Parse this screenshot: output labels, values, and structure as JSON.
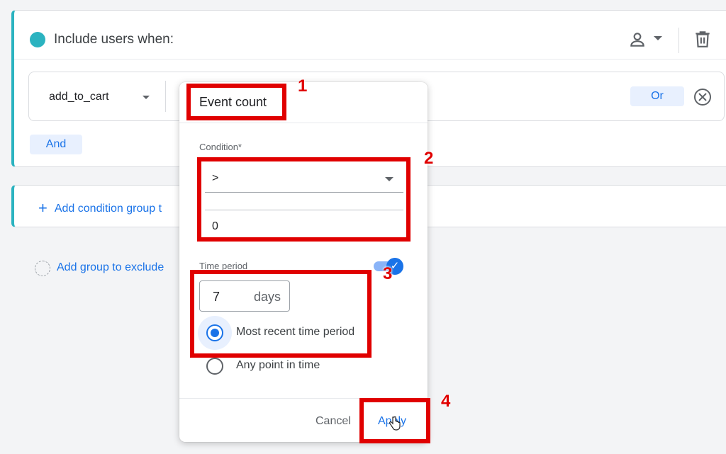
{
  "segment": {
    "include_title": "Include users when:",
    "event_name": "add_to_cart",
    "or_label": "Or",
    "and_label": "And",
    "add_condition_group": "Add condition group t",
    "add_group_exclude": "Add group to exclude"
  },
  "popup": {
    "title": "Event count",
    "condition_label": "Condition*",
    "operator": ">",
    "value": "0",
    "time_period_label": "Time period",
    "time_period_enabled": true,
    "days_value": "7",
    "days_unit": "days",
    "radio_options": [
      {
        "label": "Most recent time period",
        "selected": true
      },
      {
        "label": "Any point in time",
        "selected": false
      }
    ],
    "cancel_label": "Cancel",
    "apply_label": "Apply"
  },
  "annotations": {
    "badges": [
      "1",
      "2",
      "3",
      "4"
    ],
    "color": "#e00000"
  },
  "colors": {
    "accent": "#2bb3c0",
    "primary": "#1a73e8"
  }
}
